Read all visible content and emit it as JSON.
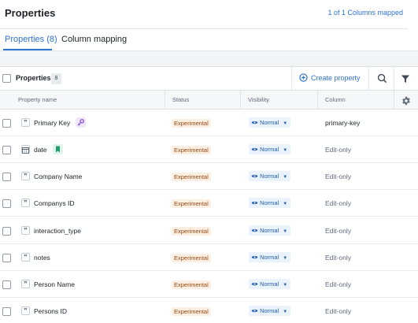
{
  "header": {
    "title": "Properties",
    "mapped_status": "1 of 1 Columns mapped"
  },
  "tabs": [
    {
      "label": "Properties (8)",
      "active": true
    },
    {
      "label": "Column mapping",
      "active": false
    }
  ],
  "toolbar": {
    "title": "Properties",
    "count": "8",
    "create_label": "Create property"
  },
  "columns": {
    "name": "Property name",
    "status": "Status",
    "visibility": "Visibility",
    "column": "Column"
  },
  "rows": [
    {
      "name": "Primary Key",
      "type_icon": "string-quote-icon",
      "badge": "key-icon",
      "status": "Experimental",
      "visibility": "Normal",
      "column": "primary-key"
    },
    {
      "name": "date",
      "type_icon": "calendar-icon",
      "badge": "bookmark-icon",
      "status": "Experimental",
      "visibility": "Normal",
      "column": "Edit-only"
    },
    {
      "name": "Company Name",
      "type_icon": "string-quote-icon",
      "status": "Experimental",
      "visibility": "Normal",
      "column": "Edit-only"
    },
    {
      "name": "Companys ID",
      "type_icon": "string-quote-icon",
      "status": "Experimental",
      "visibility": "Normal",
      "column": "Edit-only"
    },
    {
      "name": "interaction_type",
      "type_icon": "string-quote-icon",
      "status": "Experimental",
      "visibility": "Normal",
      "column": "Edit-only"
    },
    {
      "name": "notes",
      "type_icon": "string-quote-icon",
      "status": "Experimental",
      "visibility": "Normal",
      "column": "Edit-only"
    },
    {
      "name": "Person Name",
      "type_icon": "string-quote-icon",
      "status": "Experimental",
      "visibility": "Normal",
      "column": "Edit-only"
    },
    {
      "name": "Persons ID",
      "type_icon": "string-quote-icon",
      "status": "Experimental",
      "visibility": "Normal",
      "column": "Edit-only"
    }
  ],
  "colors": {
    "accent": "#2d72d2",
    "status_bg": "#fbeee2",
    "status_text": "#96490f",
    "visibility_bg": "#eaf2fc",
    "key_badge": "#8f5cd6",
    "bookmark_badge": "#1f9e6e"
  }
}
